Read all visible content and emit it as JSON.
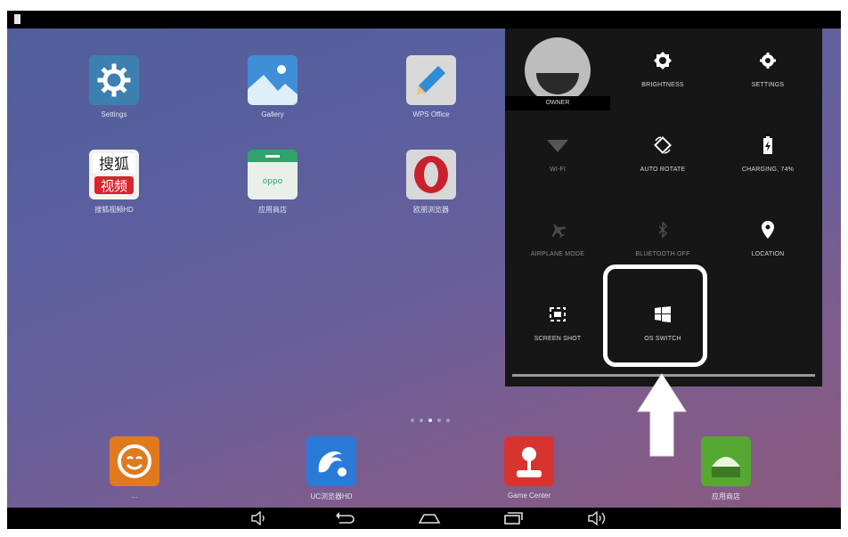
{
  "home_apps": [
    {
      "label": "Settings",
      "icon": "gear-icon",
      "color": "#3d7fb0"
    },
    {
      "label": "Gallery",
      "icon": "gallery-icon",
      "color": "#3e8fd6"
    },
    {
      "label": "WPS Office",
      "icon": "pencil-icon",
      "color": "#d9d9d9"
    },
    {
      "label": "搜狐视频HD",
      "icon": "sohu-video-icon",
      "color": "#f2f2f2"
    },
    {
      "label": "应用商店",
      "icon": "oppo-store-icon",
      "color": "#2fa36a"
    },
    {
      "label": "欧朋浏览器",
      "icon": "opera-icon",
      "color": "#d8d8d8"
    }
  ],
  "dock_apps": [
    {
      "label": "…",
      "icon": "smiley-icon",
      "color": "#e07a1f"
    },
    {
      "label": "UC浏览器HD",
      "icon": "uc-browser-icon",
      "color": "#2a7bd8"
    },
    {
      "label": "Game Center",
      "icon": "joystick-icon",
      "color": "#d8342f"
    },
    {
      "label": "应用商店",
      "icon": "android-market-icon",
      "color": "#56a832"
    }
  ],
  "quick_settings": {
    "owner": "OWNER",
    "brightness": "BRIGHTNESS",
    "settings": "SETTINGS",
    "wifi": "WI-FI",
    "auto_rotate": "AUTO ROTATE",
    "charging": "CHARGING, 74%",
    "airplane": "AIRPLANE MODE",
    "bluetooth": "BLUETOOTH OFF",
    "location": "LOCATION",
    "screenshot": "SCREEN SHOT",
    "os_switch": "OS SWITCH"
  },
  "colors": {
    "panel_bg": "#161616",
    "highlight": "#ffffff"
  }
}
